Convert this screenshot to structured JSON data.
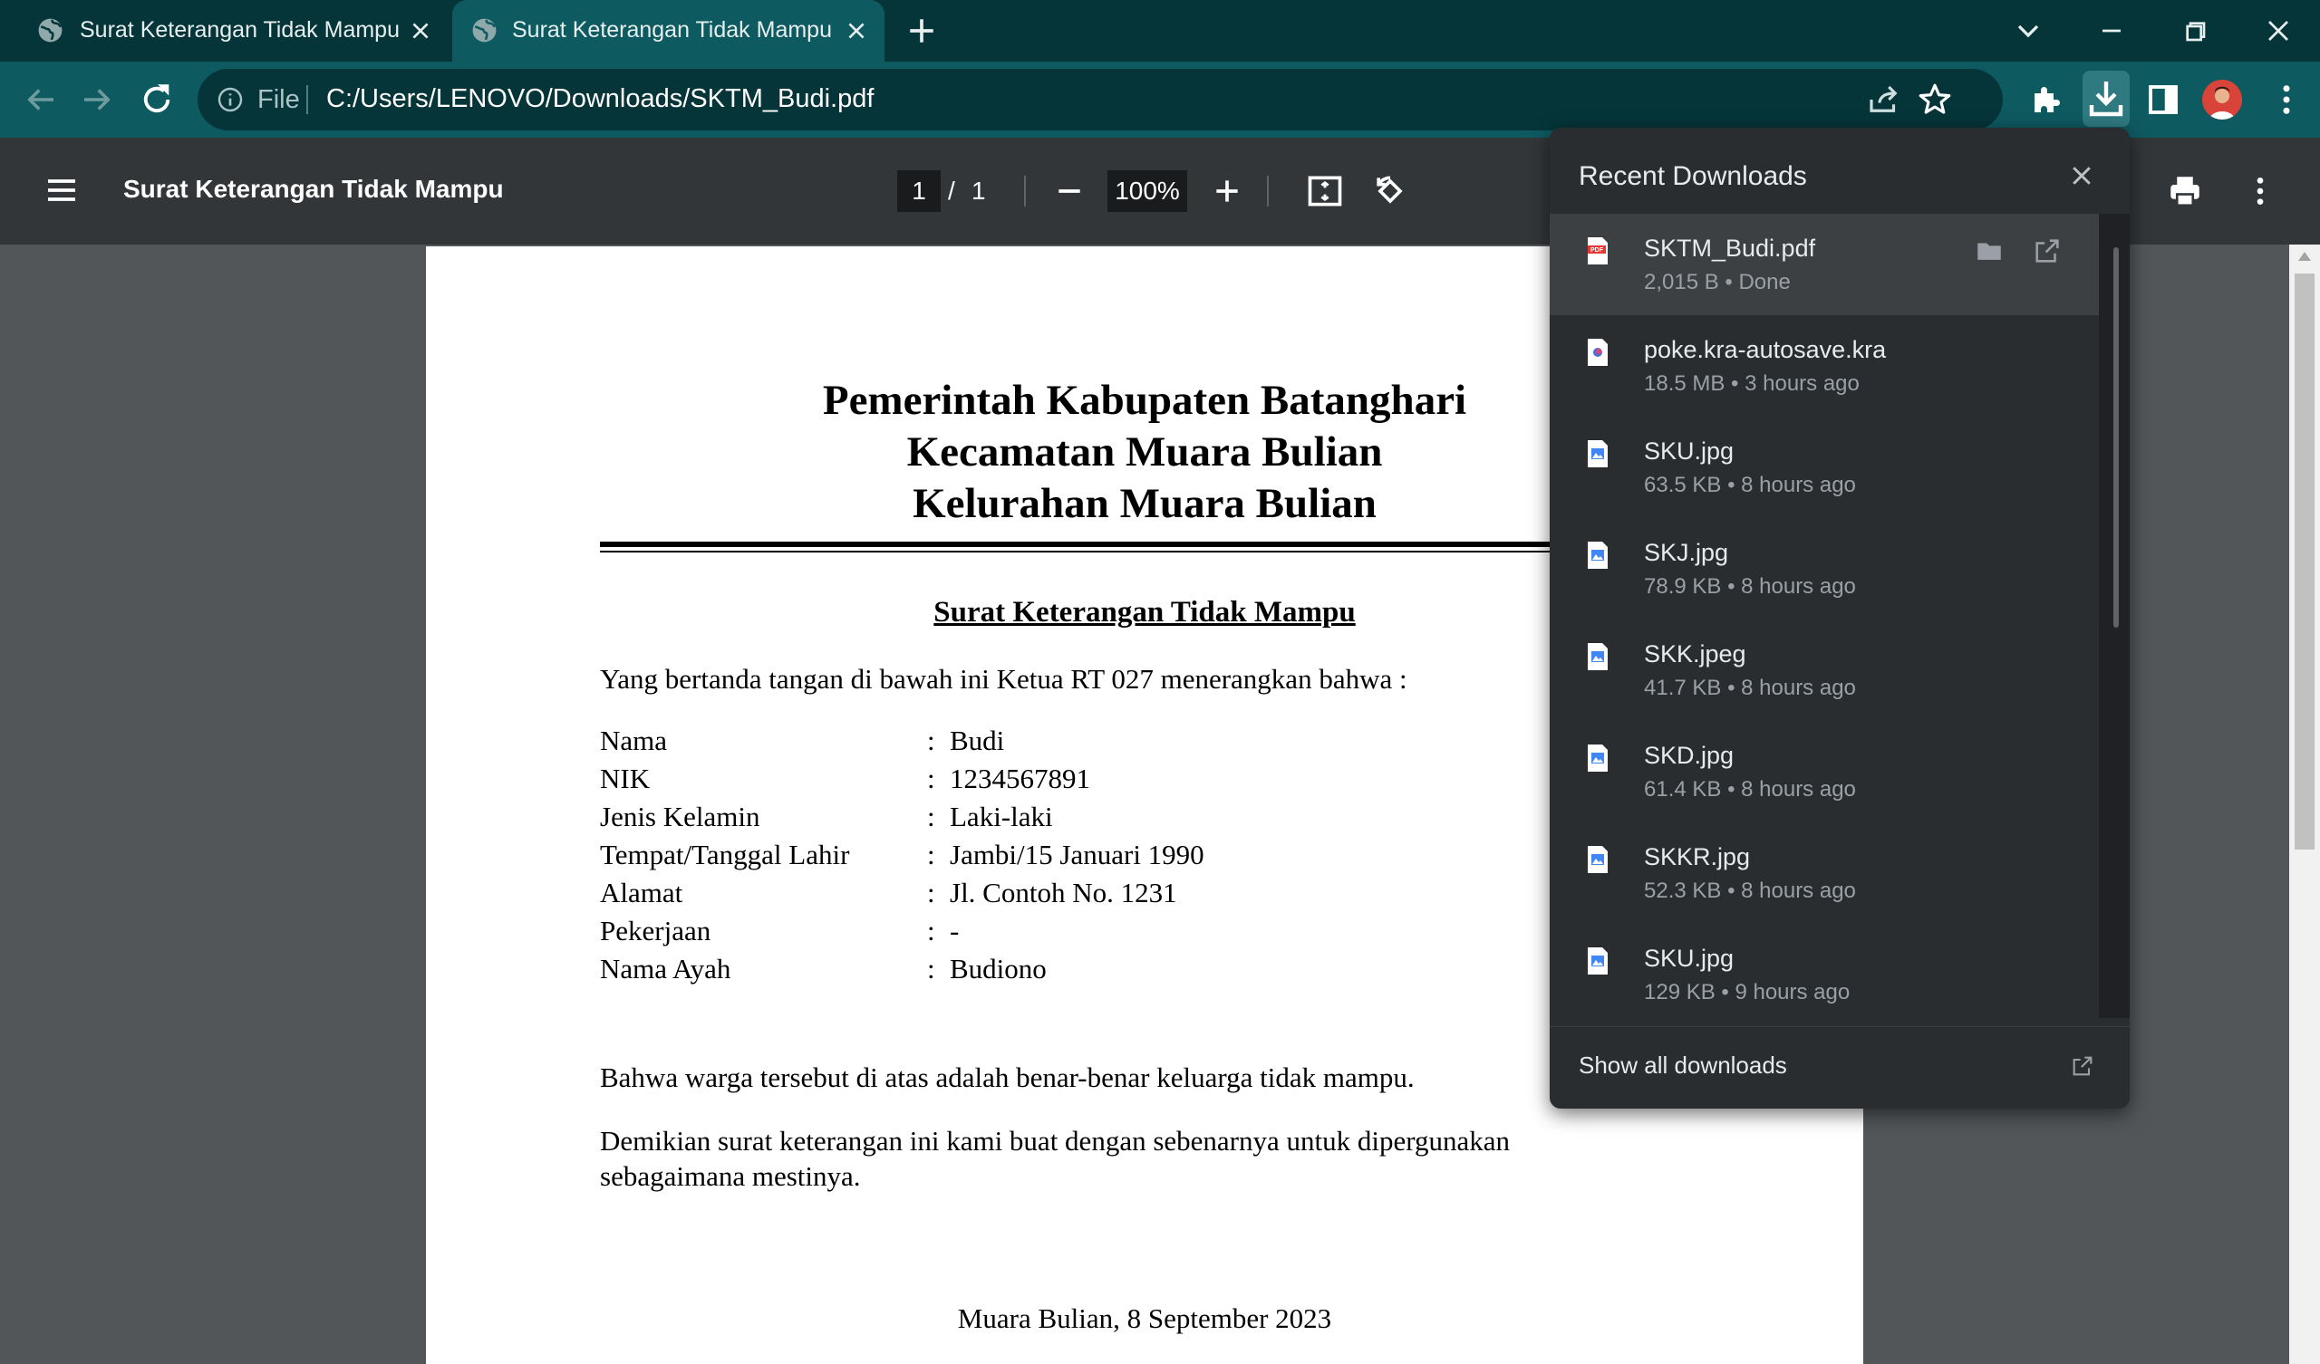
{
  "browser": {
    "tabs": [
      {
        "title": "Surat Keterangan Tidak Mampu",
        "active": false
      },
      {
        "title": "Surat Keterangan Tidak Mampu",
        "active": true
      }
    ],
    "address_scheme": "File",
    "address_url": "C:/Users/LENOVO/Downloads/SKTM_Budi.pdf"
  },
  "pdf_toolbar": {
    "title": "Surat Keterangan Tidak Mampu",
    "current_page": "1",
    "page_separator": "/",
    "total_pages": "1",
    "zoom": "100%"
  },
  "document": {
    "header_line1": "Pemerintah Kabupaten Batanghari",
    "header_line2": "Kecamatan Muara Bulian",
    "header_line3": "Kelurahan Muara Bulian",
    "subject": "Surat Keterangan Tidak Mampu",
    "intro": "Yang bertanda tangan di bawah ini Ketua RT 027 menerangkan bahwa :",
    "fields": [
      {
        "label": "Nama",
        "colon": ":",
        "value": "Budi"
      },
      {
        "label": "NIK",
        "colon": ":",
        "value": "1234567891"
      },
      {
        "label": "Jenis Kelamin",
        "colon": ":",
        "value": "Laki-laki"
      },
      {
        "label": "Tempat/Tanggal Lahir",
        "colon": ":",
        "value": "Jambi/15 Januari 1990"
      },
      {
        "label": "Alamat",
        "colon": ":",
        "value": "Jl. Contoh No. 1231"
      },
      {
        "label": "Pekerjaan",
        "colon": ":",
        "value": "-"
      },
      {
        "label": "Nama Ayah",
        "colon": ":",
        "value": "Budiono"
      }
    ],
    "statement": "Bahwa warga tersebut di atas adalah benar-benar keluarga tidak mampu.",
    "closing_line1": "Demikian surat keterangan ini kami buat dengan sebenarnya untuk dipergunakan",
    "closing_line2": "sebagaimana mestinya.",
    "place_date": "Muara Bulian, 8 September 2023"
  },
  "downloads": {
    "title": "Recent Downloads",
    "items": [
      {
        "name": "SKTM_Budi.pdf",
        "meta": "2,015 B • Done",
        "icon": "pdf-file-icon"
      },
      {
        "name": "poke.kra-autosave.kra",
        "meta": "18.5 MB • 3 hours ago",
        "icon": "kra-file-icon"
      },
      {
        "name": "SKU.jpg",
        "meta": "63.5 KB • 8 hours ago",
        "icon": "image-file-icon"
      },
      {
        "name": "SKJ.jpg",
        "meta": "78.9 KB • 8 hours ago",
        "icon": "image-file-icon"
      },
      {
        "name": "SKK.jpeg",
        "meta": "41.7 KB • 8 hours ago",
        "icon": "image-file-icon"
      },
      {
        "name": "SKD.jpg",
        "meta": "61.4 KB • 8 hours ago",
        "icon": "image-file-icon"
      },
      {
        "name": "SKKR.jpg",
        "meta": "52.3 KB • 8 hours ago",
        "icon": "image-file-icon"
      },
      {
        "name": "SKU.jpg",
        "meta": "129 KB • 9 hours ago",
        "icon": "image-file-icon"
      }
    ],
    "show_all": "Show all downloads"
  },
  "colors": {
    "tabstrip": "#053539",
    "toolbar": "#0e5a61",
    "pdf_toolbar": "#323639",
    "viewer_bg": "#525659",
    "downloads_panel": "#2a2d30",
    "selected_download": "#3c4043"
  }
}
